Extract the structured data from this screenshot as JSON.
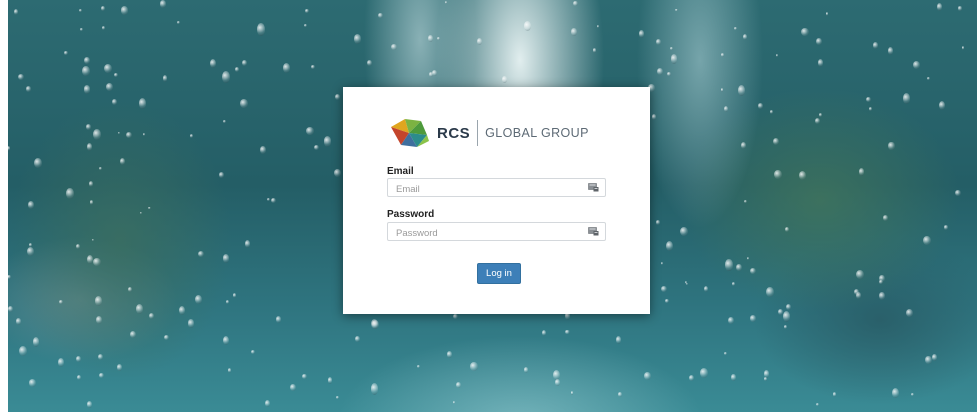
{
  "brand": {
    "name": "RCS",
    "tagline": "GLOBAL GROUP"
  },
  "login_form": {
    "email_label": "Email",
    "email_placeholder": "Email",
    "email_value": "",
    "password_label": "Password",
    "password_placeholder": "Password",
    "password_value": "",
    "submit_label": "Log in"
  },
  "icons": {
    "email_field_icon": "autofill-card-icon",
    "password_field_icon": "autofill-card-icon"
  },
  "colors": {
    "button": "#3d7fb8",
    "brand_text": "#2b3a4a",
    "logo_green": "#7cb342",
    "logo_gold": "#e0a61f",
    "logo_teal": "#2c8c8c"
  }
}
